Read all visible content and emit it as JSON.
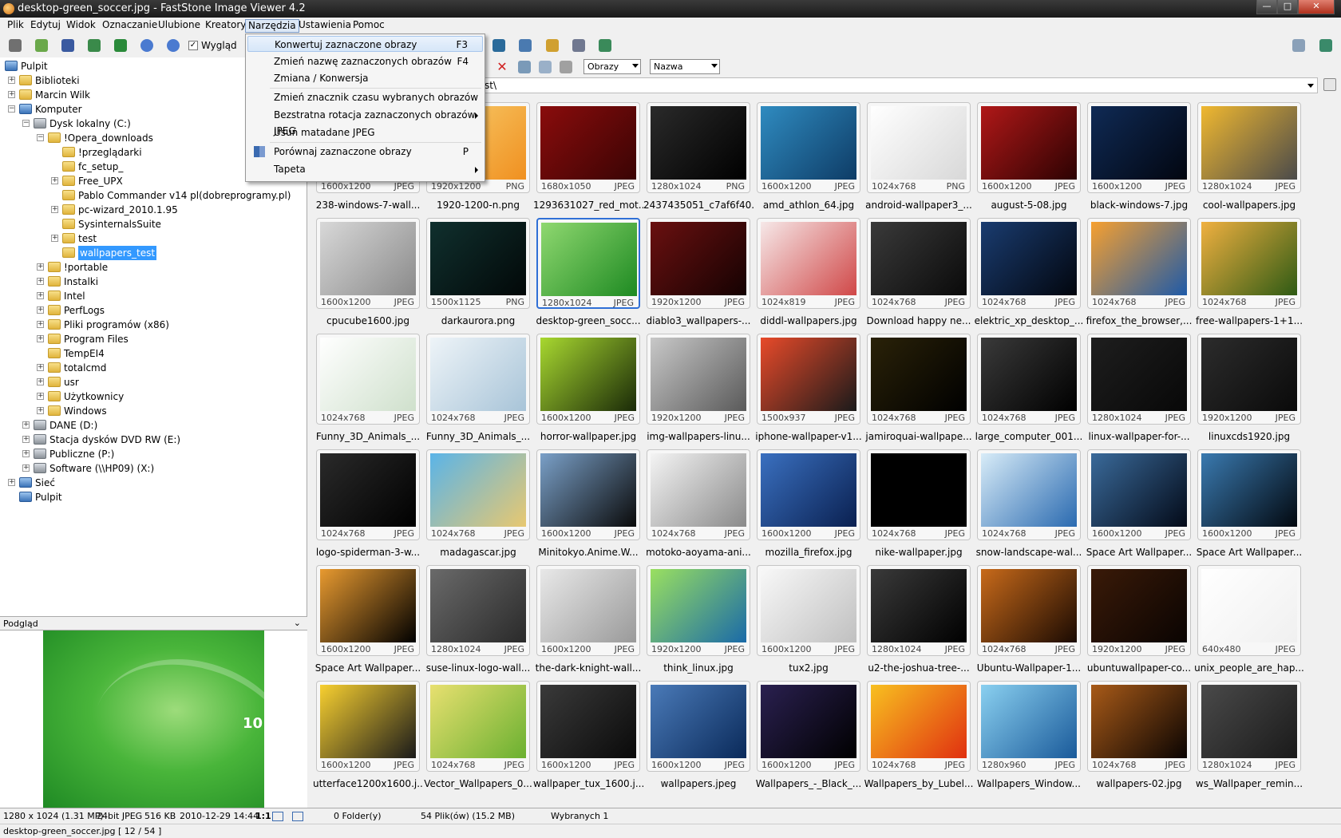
{
  "window": {
    "title": "desktop-green_soccer.jpg - FastStone Image Viewer 4.2",
    "min_glyph": "—",
    "max_glyph": "□",
    "close_glyph": "✕"
  },
  "menu": [
    "Plik",
    "Edytuj",
    "Widok",
    "Oznaczanie",
    "Ulubione",
    "Kreatory",
    "Narzędzia",
    "Ustawienia",
    "Pomoc"
  ],
  "toolbar": {
    "appearance_label": "Wygląd",
    "filter_value": "Obrazy",
    "sort_value": "Nazwa",
    "path_value": "C:\\!Opera_downloads\\wallpapers_test\\",
    "path_visible": "st\\"
  },
  "dropdown": {
    "items": [
      {
        "label": "Konwertuj zaznaczone obrazy",
        "key": "F3"
      },
      {
        "label": "Zmień nazwę zaznaczonych obrazów",
        "key": "F4"
      },
      {
        "label": "Zmiana / Konwersja",
        "key": ""
      },
      {
        "label": "Zmień znacznik czasu wybranych obrazów",
        "key": ""
      },
      {
        "label": "Bezstratna rotacja zaznaczonych obrazów JPEG",
        "key": ""
      },
      {
        "label": "Usuń matadane JPEG",
        "key": ""
      },
      {
        "label": "Porównaj zaznaczone obrazy",
        "key": "P"
      },
      {
        "label": "Tapeta",
        "key": ""
      }
    ]
  },
  "tree": [
    {
      "label": "Pulpit",
      "level": 0,
      "type": "pc",
      "exp": ""
    },
    {
      "label": "Biblioteki",
      "level": 1,
      "type": "folder",
      "exp": "+"
    },
    {
      "label": "Marcin Wilk",
      "level": 1,
      "type": "folder",
      "exp": "+"
    },
    {
      "label": "Komputer",
      "level": 1,
      "type": "pc",
      "exp": "−"
    },
    {
      "label": "Dysk lokalny (C:)",
      "level": 2,
      "type": "drive",
      "exp": "−"
    },
    {
      "label": "!Opera_downloads",
      "level": 3,
      "type": "folder",
      "exp": "−"
    },
    {
      "label": "!przeglądarki",
      "level": 4,
      "type": "folder",
      "exp": ""
    },
    {
      "label": "fc_setup_",
      "level": 4,
      "type": "folder",
      "exp": ""
    },
    {
      "label": "Free_UPX",
      "level": 4,
      "type": "folder",
      "exp": "+"
    },
    {
      "label": "Pablo Commander v14 pl(dobreprogramy.pl)",
      "level": 4,
      "type": "folder",
      "exp": ""
    },
    {
      "label": "pc-wizard_2010.1.95",
      "level": 4,
      "type": "folder",
      "exp": "+"
    },
    {
      "label": "SysinternalsSuite",
      "level": 4,
      "type": "folder",
      "exp": ""
    },
    {
      "label": "test",
      "level": 4,
      "type": "folder",
      "exp": "+"
    },
    {
      "label": "wallpapers_test",
      "level": 4,
      "type": "folder",
      "exp": "",
      "selected": true
    },
    {
      "label": "!portable",
      "level": 3,
      "type": "folder",
      "exp": "+"
    },
    {
      "label": "Instalki",
      "level": 3,
      "type": "folder",
      "exp": "+"
    },
    {
      "label": "Intel",
      "level": 3,
      "type": "folder",
      "exp": "+"
    },
    {
      "label": "PerfLogs",
      "level": 3,
      "type": "folder",
      "exp": "+"
    },
    {
      "label": "Pliki programów (x86)",
      "level": 3,
      "type": "folder",
      "exp": "+"
    },
    {
      "label": "Program Files",
      "level": 3,
      "type": "folder",
      "exp": "+"
    },
    {
      "label": "TempEI4",
      "level": 3,
      "type": "folder",
      "exp": ""
    },
    {
      "label": "totalcmd",
      "level": 3,
      "type": "folder",
      "exp": "+"
    },
    {
      "label": "usr",
      "level": 3,
      "type": "folder",
      "exp": "+"
    },
    {
      "label": "Użytkownicy",
      "level": 3,
      "type": "folder",
      "exp": "+"
    },
    {
      "label": "Windows",
      "level": 3,
      "type": "folder",
      "exp": "+"
    },
    {
      "label": "DANE (D:)",
      "level": 2,
      "type": "drive",
      "exp": "+"
    },
    {
      "label": "Stacja dysków DVD RW (E:)",
      "level": 2,
      "type": "drive",
      "exp": "+"
    },
    {
      "label": "Publiczne (P:)",
      "level": 2,
      "type": "drive",
      "exp": "+"
    },
    {
      "label": "Software (\\\\HP09) (X:)",
      "level": 2,
      "type": "drive",
      "exp": "+"
    },
    {
      "label": "Sieć",
      "level": 1,
      "type": "pc",
      "exp": "+"
    },
    {
      "label": "Pulpit",
      "level": 1,
      "type": "pc",
      "exp": ""
    }
  ],
  "preview": {
    "label": "Podgląd",
    "chevron": "⌄",
    "overlay_number": "10"
  },
  "thumbnails": [
    {
      "name": "238-windows-7-wall...",
      "dims": "1600x1200",
      "fmt": "JPEG",
      "c1": "#f3c04b",
      "c2": "#e46a14"
    },
    {
      "name": "1920-1200-n.png",
      "dims": "1920x1200",
      "fmt": "PNG",
      "c1": "#f8d070",
      "c2": "#f09020"
    },
    {
      "name": "1293631027_red_mot...",
      "dims": "1680x1050",
      "fmt": "JPEG",
      "c1": "#8a0c0c",
      "c2": "#3a0404"
    },
    {
      "name": "2437435051_c7af6f40...",
      "dims": "1280x1024",
      "fmt": "PNG",
      "c1": "#2a2a2a",
      "c2": "#000000"
    },
    {
      "name": "amd_athlon_64.jpg",
      "dims": "1600x1200",
      "fmt": "JPEG",
      "c1": "#2f8bc0",
      "c2": "#0e3c66"
    },
    {
      "name": "android-wallpaper3_...",
      "dims": "1024x768",
      "fmt": "PNG",
      "c1": "#ffffff",
      "c2": "#d8d8d8"
    },
    {
      "name": "august-5-08.jpg",
      "dims": "1600x1200",
      "fmt": "JPEG",
      "c1": "#b01818",
      "c2": "#2c0202"
    },
    {
      "name": "black-windows-7.jpg",
      "dims": "1600x1200",
      "fmt": "JPEG",
      "c1": "#0f2a55",
      "c2": "#020610"
    },
    {
      "name": "cool-wallpapers.jpg",
      "dims": "1280x1024",
      "fmt": "JPEG",
      "c1": "#f0b830",
      "c2": "#4a4a4a"
    },
    {
      "name": "cpucube1600.jpg",
      "dims": "1600x1200",
      "fmt": "JPEG",
      "c1": "#d8d8d8",
      "c2": "#8a8a8a"
    },
    {
      "name": "darkaurora.png",
      "dims": "1500x1125",
      "fmt": "PNG",
      "c1": "#10302e",
      "c2": "#020808"
    },
    {
      "name": "desktop-green_socc...",
      "dims": "1280x1024",
      "fmt": "JPEG",
      "c1": "#8fd870",
      "c2": "#1e8a22",
      "selected": true
    },
    {
      "name": "diablo3_wallpapers-...",
      "dims": "1920x1200",
      "fmt": "JPEG",
      "c1": "#6a1010",
      "c2": "#150202"
    },
    {
      "name": "diddl-wallpapers.jpg",
      "dims": "1024x819",
      "fmt": "JPEG",
      "c1": "#f6e8e8",
      "c2": "#d04848"
    },
    {
      "name": "Download happy ne...",
      "dims": "1024x768",
      "fmt": "JPEG",
      "c1": "#3a3a3a",
      "c2": "#0a0a0a"
    },
    {
      "name": "elektric_xp_desktop_...",
      "dims": "1024x768",
      "fmt": "JPEG",
      "c1": "#1a3c70",
      "c2": "#02060e"
    },
    {
      "name": "firefox_the_browser,...",
      "dims": "1024x768",
      "fmt": "JPEG",
      "c1": "#f6a030",
      "c2": "#1e5aa8"
    },
    {
      "name": "free-wallpapers-1+1...",
      "dims": "1024x768",
      "fmt": "JPEG",
      "c1": "#f0b040",
      "c2": "#2e5a14"
    },
    {
      "name": "Funny_3D_Animals_...",
      "dims": "1024x768",
      "fmt": "JPEG",
      "c1": "#ffffff",
      "c2": "#cfe0cc"
    },
    {
      "name": "Funny_3D_Animals_...",
      "dims": "1024x768",
      "fmt": "JPEG",
      "c1": "#eef4f8",
      "c2": "#a8c4d8"
    },
    {
      "name": "horror-wallpaper.jpg",
      "dims": "1600x1200",
      "fmt": "JPEG",
      "c1": "#a8d830",
      "c2": "#1a2a08"
    },
    {
      "name": "img-wallpapers-linu...",
      "dims": "1920x1200",
      "fmt": "JPEG",
      "c1": "#c8c8c8",
      "c2": "#5a5a5a"
    },
    {
      "name": "iphone-wallpaper-v1...",
      "dims": "1500x937",
      "fmt": "JPEG",
      "c1": "#e84a2a",
      "c2": "#1a1a1a"
    },
    {
      "name": "jamiroquai-wallpape...",
      "dims": "1024x768",
      "fmt": "JPEG",
      "c1": "#2a2208",
      "c2": "#000000"
    },
    {
      "name": "large_computer_001...",
      "dims": "1024x768",
      "fmt": "JPEG",
      "c1": "#3a3a3a",
      "c2": "#000000"
    },
    {
      "name": "linux-wallpaper-for-...",
      "dims": "1280x1024",
      "fmt": "JPEG",
      "c1": "#1e1e1e",
      "c2": "#080808"
    },
    {
      "name": "linuxcds1920.jpg",
      "dims": "1920x1200",
      "fmt": "JPEG",
      "c1": "#2c2c2c",
      "c2": "#0a0a0a"
    },
    {
      "name": "logo-spiderman-3-w...",
      "dims": "1024x768",
      "fmt": "JPEG",
      "c1": "#2a2a2a",
      "c2": "#000000"
    },
    {
      "name": "madagascar.jpg",
      "dims": "1024x768",
      "fmt": "JPEG",
      "c1": "#5ab4e8",
      "c2": "#e8c870"
    },
    {
      "name": "Minitokyo.Anime.W...",
      "dims": "1600x1200",
      "fmt": "JPEG",
      "c1": "#7aa0c8",
      "c2": "#0a0a0a"
    },
    {
      "name": "motoko-aoyama-ani...",
      "dims": "1024x768",
      "fmt": "JPEG",
      "c1": "#f4f4f4",
      "c2": "#8a8a8a"
    },
    {
      "name": "mozilla_firefox.jpg",
      "dims": "1600x1200",
      "fmt": "JPEG",
      "c1": "#3a70c0",
      "c2": "#0a2050"
    },
    {
      "name": "nike-wallpaper.jpg",
      "dims": "1024x768",
      "fmt": "JPEG",
      "c1": "#000000",
      "c2": "#000000"
    },
    {
      "name": "snow-landscape-wal...",
      "dims": "1024x768",
      "fmt": "JPEG",
      "c1": "#d8ecf8",
      "c2": "#2a6ab0"
    },
    {
      "name": "Space Art Wallpaper...",
      "dims": "1600x1200",
      "fmt": "JPEG",
      "c1": "#3a6a9a",
      "c2": "#030a18"
    },
    {
      "name": "Space Art Wallpaper...",
      "dims": "1600x1200",
      "fmt": "JPEG",
      "c1": "#3a7ab0",
      "c2": "#02080f"
    },
    {
      "name": "Space Art Wallpaper...",
      "dims": "1600x1200",
      "fmt": "JPEG",
      "c1": "#e89a30",
      "c2": "#000000"
    },
    {
      "name": "suse-linux-logo-wall...",
      "dims": "1280x1024",
      "fmt": "JPEG",
      "c1": "#6a6a6a",
      "c2": "#2a2a2a"
    },
    {
      "name": "the-dark-knight-wall...",
      "dims": "1600x1200",
      "fmt": "JPEG",
      "c1": "#e8e8e8",
      "c2": "#9a9a9a"
    },
    {
      "name": "think_linux.jpg",
      "dims": "1920x1200",
      "fmt": "JPEG",
      "c1": "#9ae060",
      "c2": "#1a6aa8"
    },
    {
      "name": "tux2.jpg",
      "dims": "1600x1200",
      "fmt": "JPEG",
      "c1": "#f8f8f8",
      "c2": "#c0c0c0"
    },
    {
      "name": "u2-the-joshua-tree-...",
      "dims": "1280x1024",
      "fmt": "JPEG",
      "c1": "#3a3a3a",
      "c2": "#000000"
    },
    {
      "name": "Ubuntu-Wallpaper-1...",
      "dims": "1024x768",
      "fmt": "JPEG",
      "c1": "#c86a1a",
      "c2": "#1a0a02"
    },
    {
      "name": "ubuntuwallpaper-co...",
      "dims": "1920x1200",
      "fmt": "JPEG",
      "c1": "#3a1a08",
      "c2": "#0a0402"
    },
    {
      "name": "unix_people_are_hap...",
      "dims": "640x480",
      "fmt": "JPEG",
      "c1": "#ffffff",
      "c2": "#f0f0f0"
    },
    {
      "name": "utterface1200x1600.j...",
      "dims": "1600x1200",
      "fmt": "JPEG",
      "c1": "#f8d030",
      "c2": "#1a1a1a"
    },
    {
      "name": "Vector_Wallpapers_0...",
      "dims": "1024x768",
      "fmt": "JPEG",
      "c1": "#e8e070",
      "c2": "#6ab030"
    },
    {
      "name": "wallpaper_tux_1600.j...",
      "dims": "1600x1200",
      "fmt": "JPEG",
      "c1": "#3a3a3a",
      "c2": "#0a0a0a"
    },
    {
      "name": "wallpapers.jpeg",
      "dims": "1600x1200",
      "fmt": "JPEG",
      "c1": "#4a7ab8",
      "c2": "#0a2a5a"
    },
    {
      "name": "Wallpapers_-_Black_...",
      "dims": "1600x1200",
      "fmt": "JPEG",
      "c1": "#2a2050",
      "c2": "#000000"
    },
    {
      "name": "Wallpapers_by_Lubel...",
      "dims": "1024x768",
      "fmt": "JPEG",
      "c1": "#f8c020",
      "c2": "#e03010"
    },
    {
      "name": "Wallpapers_Window...",
      "dims": "1280x960",
      "fmt": "JPEG",
      "c1": "#8ad0f0",
      "c2": "#1a5a9a"
    },
    {
      "name": "wallpapers-02.jpg",
      "dims": "1024x768",
      "fmt": "JPEG",
      "c1": "#a85a18",
      "c2": "#0a0402"
    },
    {
      "name": "ws_Wallpaper_remin...",
      "dims": "1280x1024",
      "fmt": "JPEG",
      "c1": "#4a4a4a",
      "c2": "#1a1a1a"
    }
  ],
  "status": {
    "image_info": "1280 x 1024 (1.31 MP)",
    "bits": "24bit JPEG",
    "size": "516 KB",
    "date": "2010-12-29 14:44",
    "ratio": "1:1",
    "folders": "0 Folder(y)",
    "files": "54 Plik(ów) (15.2 MB)",
    "selected": "Wybranych 1",
    "current_file": "desktop-green_soccer.jpg [ 12 / 54 ]"
  }
}
